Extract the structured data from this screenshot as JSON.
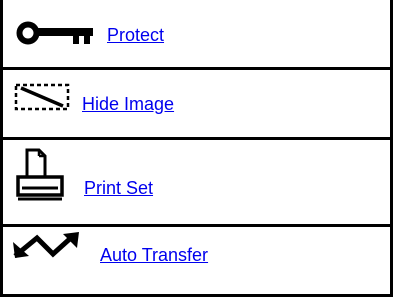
{
  "menu": {
    "items": [
      {
        "label": "Protect",
        "icon": "key-icon"
      },
      {
        "label": "Hide Image",
        "icon": "hide-image-icon"
      },
      {
        "label": "Print Set",
        "icon": "printer-icon"
      },
      {
        "label": "Auto Transfer",
        "icon": "auto-transfer-icon"
      }
    ]
  },
  "colors": {
    "link": "#0000ee",
    "border": "#000000",
    "background": "#ffffff"
  }
}
